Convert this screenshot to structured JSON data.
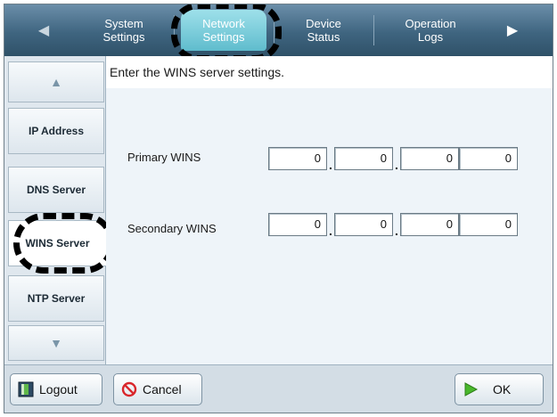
{
  "tabs": [
    {
      "label": "System\nSettings",
      "active": false
    },
    {
      "label": "Network\nSettings",
      "active": true
    },
    {
      "label": "Device\nStatus",
      "active": false
    },
    {
      "label": "Operation\nLogs",
      "active": false
    }
  ],
  "sidebar": {
    "items": [
      {
        "label": "IP Address"
      },
      {
        "label": "DNS Server"
      },
      {
        "label": "WINS Server",
        "active": true
      },
      {
        "label": "NTP Server"
      }
    ]
  },
  "main": {
    "instruction": "Enter the WINS server settings.",
    "primary": {
      "label": "Primary WINS",
      "octets": [
        "0",
        "0",
        "0",
        "0"
      ]
    },
    "secondary": {
      "label": "Secondary WINS",
      "octets": [
        "0",
        "0",
        "0",
        "0"
      ]
    }
  },
  "buttons": {
    "logout": "Logout",
    "cancel": "Cancel",
    "ok": "OK"
  },
  "colors": {
    "tab_bar": "#3f6580",
    "active_tab": "#5fbccd",
    "cancel_icon": "#d9262b",
    "ok_icon": "#49b82c"
  }
}
